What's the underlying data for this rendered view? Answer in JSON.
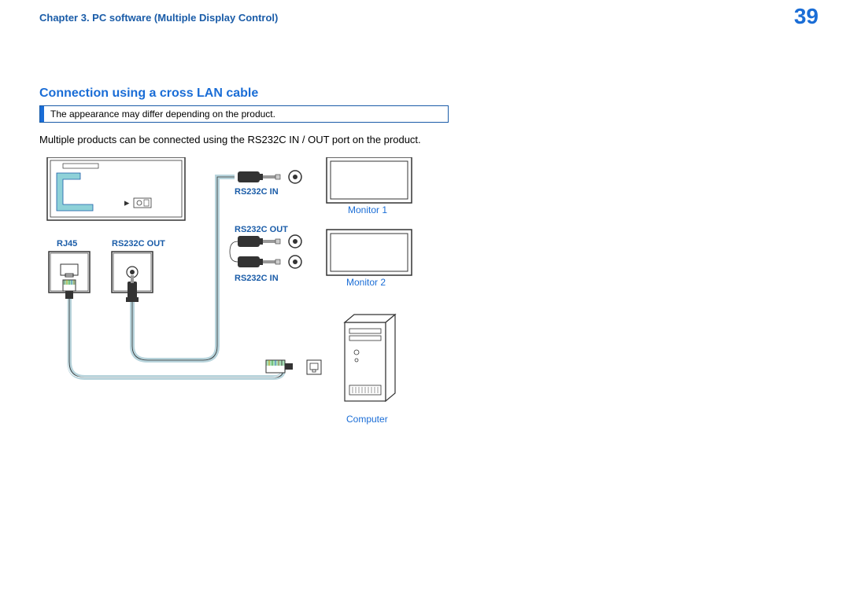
{
  "header": {
    "chapter": "Chapter 3. PC software (Multiple Display Control)",
    "page": "39"
  },
  "section": {
    "title": "Connection using a cross LAN cable",
    "notice": "The appearance may differ depending on the product.",
    "body": "Multiple products can be connected using the RS232C IN / OUT port on the product."
  },
  "labels": {
    "rj45": "RJ45",
    "rs232c_out_left": "RS232C OUT",
    "rs232c_in_top": "RS232C IN",
    "rs232c_out_mid": "RS232C OUT",
    "rs232c_in_bottom": "RS232C IN",
    "monitor1": "Monitor 1",
    "monitor2": "Monitor 2",
    "computer": "Computer"
  }
}
